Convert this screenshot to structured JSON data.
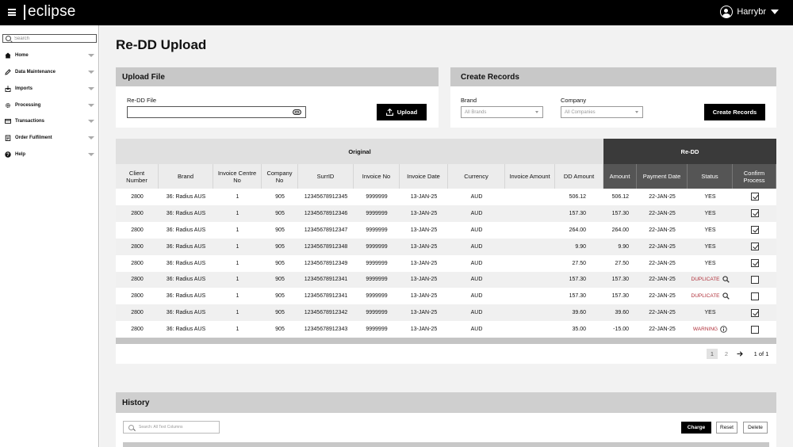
{
  "app": {
    "logo": "eclipse",
    "user_name": "Harrybr"
  },
  "sidebar": {
    "search_placeholder": "Search",
    "items": [
      {
        "label": "Home",
        "icon": "home-icon"
      },
      {
        "label": "Data Maintenance",
        "icon": "pencil-icon"
      },
      {
        "label": "Imports",
        "icon": "import-icon"
      },
      {
        "label": "Processing",
        "icon": "gear-icon"
      },
      {
        "label": "Transactions",
        "icon": "card-icon"
      },
      {
        "label": "Order Fulfilment",
        "icon": "clipboard-icon"
      },
      {
        "label": "Help",
        "icon": "help-icon"
      }
    ]
  },
  "page": {
    "title": "Re-DD Upload"
  },
  "upload": {
    "header": "Upload File",
    "field_label": "Re-DD File",
    "button": "Upload"
  },
  "create": {
    "header": "Create Records",
    "brand_label": "Brand",
    "brand_placeholder": "All Brands",
    "company_label": "Company",
    "company_placeholder": "All Companies",
    "button": "Create Records"
  },
  "table": {
    "group_original": "Original",
    "group_redd": "Re-DD",
    "headers": [
      "Client Number",
      "Brand",
      "Invoice Centre No",
      "Company No",
      "SurrID",
      "Invoice No",
      "Invoice Date",
      "Currency",
      "Invoice Amount",
      "DD Amount",
      "Amount",
      "Payment Date",
      "Status",
      "Confirm Process"
    ],
    "rows": [
      {
        "client": "2800",
        "brand": "36: Radius AUS",
        "centre": "1",
        "company": "905",
        "surr": "12345678912345",
        "inv": "9999999",
        "date": "13-JAN-25",
        "cur": "AUD",
        "invamt": "",
        "dd": "506.12",
        "amt": "506.12",
        "pay": "22-JAN-25",
        "status": "YES",
        "status_type": "ok",
        "confirm": true
      },
      {
        "client": "2800",
        "brand": "36: Radius AUS",
        "centre": "1",
        "company": "905",
        "surr": "12345678912346",
        "inv": "9999999",
        "date": "13-JAN-25",
        "cur": "AUD",
        "invamt": "",
        "dd": "157.30",
        "amt": "157.30",
        "pay": "22-JAN-25",
        "status": "YES",
        "status_type": "ok",
        "confirm": true
      },
      {
        "client": "2800",
        "brand": "36: Radius AUS",
        "centre": "1",
        "company": "905",
        "surr": "12345678912347",
        "inv": "9999999",
        "date": "13-JAN-25",
        "cur": "AUD",
        "invamt": "",
        "dd": "264.00",
        "amt": "264.00",
        "pay": "22-JAN-25",
        "status": "YES",
        "status_type": "ok",
        "confirm": true
      },
      {
        "client": "2800",
        "brand": "36: Radius AUS",
        "centre": "1",
        "company": "905",
        "surr": "12345678912348",
        "inv": "9999999",
        "date": "13-JAN-25",
        "cur": "AUD",
        "invamt": "",
        "dd": "9.90",
        "amt": "9.90",
        "pay": "22-JAN-25",
        "status": "YES",
        "status_type": "ok",
        "confirm": true
      },
      {
        "client": "2800",
        "brand": "36: Radius AUS",
        "centre": "1",
        "company": "905",
        "surr": "12345678912349",
        "inv": "9999999",
        "date": "13-JAN-25",
        "cur": "AUD",
        "invamt": "",
        "dd": "27.50",
        "amt": "27.50",
        "pay": "22-JAN-25",
        "status": "YES",
        "status_type": "ok",
        "confirm": true
      },
      {
        "client": "2800",
        "brand": "36: Radius AUS",
        "centre": "1",
        "company": "905",
        "surr": "12345678912341",
        "inv": "9999999",
        "date": "13-JAN-25",
        "cur": "AUD",
        "invamt": "",
        "dd": "157.30",
        "amt": "157.30",
        "pay": "22-JAN-25",
        "status": "DUPLICATE",
        "status_type": "duplicate",
        "confirm": false
      },
      {
        "client": "2800",
        "brand": "36: Radius AUS",
        "centre": "1",
        "company": "905",
        "surr": "12345678912341",
        "inv": "9999999",
        "date": "13-JAN-25",
        "cur": "AUD",
        "invamt": "",
        "dd": "157.30",
        "amt": "157.30",
        "pay": "22-JAN-25",
        "status": "DUPLICATE",
        "status_type": "duplicate",
        "confirm": false
      },
      {
        "client": "2800",
        "brand": "36: Radius AUS",
        "centre": "1",
        "company": "905",
        "surr": "12345678912342",
        "inv": "9999999",
        "date": "13-JAN-25",
        "cur": "AUD",
        "invamt": "",
        "dd": "39.60",
        "amt": "39.60",
        "pay": "22-JAN-25",
        "status": "YES",
        "status_type": "ok",
        "confirm": true
      },
      {
        "client": "2800",
        "brand": "36: Radius AUS",
        "centre": "1",
        "company": "905",
        "surr": "12345678912343",
        "inv": "9999999",
        "date": "13-JAN-25",
        "cur": "AUD",
        "invamt": "",
        "dd": "35.00",
        "amt": "-15.00",
        "pay": "22-JAN-25",
        "status": "WARNING",
        "status_type": "warning",
        "confirm": false
      }
    ]
  },
  "pagination": {
    "pages": [
      "1",
      "2"
    ],
    "current": "1",
    "summary": "1 of 1"
  },
  "history": {
    "header": "History",
    "search_placeholder": "Search: All Text Columns",
    "charge": "Charge",
    "reset": "Reset",
    "delete": "Delete"
  },
  "colors": {
    "topbar": "#000000",
    "panel_header": "#c8c8c8",
    "redd_header": "#3a3a3a",
    "status_alert": "#b0303a"
  }
}
